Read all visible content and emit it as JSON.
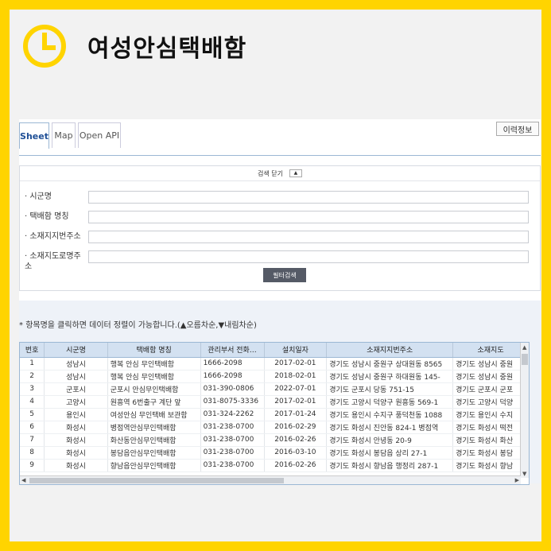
{
  "header": {
    "title": "여성안심택배함",
    "clock_icon": "clock-icon",
    "accent": "#ffd400"
  },
  "tabs": [
    {
      "label": "Sheet",
      "active": true
    },
    {
      "label": "Map",
      "active": false
    },
    {
      "label": "Open API",
      "active": false
    }
  ],
  "history_button": "이력정보",
  "search": {
    "head_label": "검색 닫기",
    "toggle_icon": "▲",
    "fields": [
      {
        "label": "시군명",
        "value": ""
      },
      {
        "label": "택배함 명칭",
        "value": ""
      },
      {
        "label": "소재지지번주소",
        "value": ""
      },
      {
        "label": "소재지도로명주소",
        "value": ""
      }
    ],
    "filter_button": "필터검색"
  },
  "hint": "항목명을 클릭하면 데이터 정렬이 가능합니다.(▲오름차순,▼내림차순)",
  "table": {
    "columns": [
      "번호",
      "시군명",
      "택배함 명칭",
      "관리부서 전화…",
      "설치일자",
      "소재지지번주소",
      "소재지도"
    ],
    "rows": [
      [
        "1",
        "성남시",
        "행복 안심 무인택배함",
        "1666-2098",
        "2017-02-01",
        "경기도 성남시 중원구 상대원동 8565",
        "경기도 성남시 중원"
      ],
      [
        "2",
        "성남시",
        "행복 안심 무인택배함",
        "1666-2098",
        "2018-02-01",
        "경기도 성남시 중원구 하대원동 145-",
        "경기도 성남시 중원"
      ],
      [
        "3",
        "군포시",
        "군포시 안심무인택배함",
        "031-390-0806",
        "2022-07-01",
        "경기도 군포시 당동 751-15",
        "경기도 군포시 군포"
      ],
      [
        "4",
        "고양시",
        "원흥역 6번출구 계단 앞",
        "031-8075-3336",
        "2017-02-01",
        "경기도 고양시 덕양구 원흥동 569-1",
        "경기도 고양시 덕양"
      ],
      [
        "5",
        "용인시",
        "여성안심 무인택배 보관함",
        "031-324-2262",
        "2017-01-24",
        "경기도 용인시 수지구 풍덕천동 1088",
        "경기도 용인시 수지"
      ],
      [
        "6",
        "화성시",
        "병점역안심무인택배함",
        "031-238-0700",
        "2016-02-29",
        "경기도 화성시 진안동 824-1 병점역",
        "경기도 화성시 떡전"
      ],
      [
        "7",
        "화성시",
        "화산동안심무인택배함",
        "031-238-0700",
        "2016-02-26",
        "경기도 화성시 안녕동 20-9",
        "경기도 화성시 화산"
      ],
      [
        "8",
        "화성시",
        "봉담읍안심무인택배함",
        "031-238-0700",
        "2016-03-10",
        "경기도 화성시 봉담읍 상리 27-1",
        "경기도 화성시 봉담"
      ],
      [
        "9",
        "화성시",
        "향남읍안심무인택배함",
        "031-238-0700",
        "2016-02-26",
        "경기도 화성시 향남읍 행정리 287-1",
        "경기도 화성시 향남"
      ]
    ]
  }
}
